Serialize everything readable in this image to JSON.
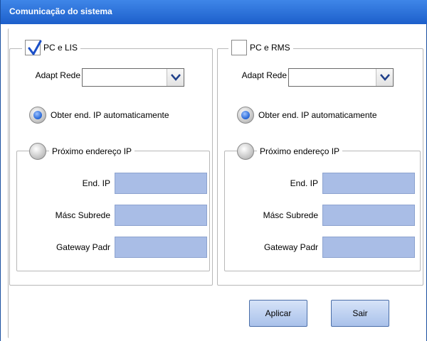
{
  "window": {
    "title": "Comunicação do sistema"
  },
  "left_panel": {
    "checkbox_label": "PC e LIS",
    "checkbox_checked": true,
    "adapter_label": "Adapt Rede",
    "adapter_value": "",
    "radio_auto_label": "Obter end. IP automaticamente",
    "radio_auto_checked": true,
    "radio_next_label": "Próximo endereço IP",
    "radio_next_checked": false,
    "ip_label": "End. IP",
    "ip_value": "",
    "subnet_label": "Másc Subrede",
    "subnet_value": "",
    "gateway_label": "Gateway Padr",
    "gateway_value": ""
  },
  "right_panel": {
    "checkbox_label": "PC e RMS",
    "checkbox_checked": false,
    "adapter_label": "Adapt Rede",
    "adapter_value": "",
    "radio_auto_label": "Obter end. IP automaticamente",
    "radio_auto_checked": true,
    "radio_next_label": "Próximo endereço IP",
    "radio_next_checked": false,
    "ip_label": "End. IP",
    "ip_value": "",
    "subnet_label": "Másc Subrede",
    "subnet_value": "",
    "gateway_label": "Gateway Padr",
    "gateway_value": ""
  },
  "buttons": {
    "apply": "Aplicar",
    "exit": "Sair"
  },
  "colors": {
    "titlebar": "#2a6ad8",
    "field_fill": "#a9bde6",
    "radio_selected": "#2a6ad8"
  },
  "icons": {
    "check": "checkmark-icon",
    "dropdown": "chevron-down-icon"
  }
}
